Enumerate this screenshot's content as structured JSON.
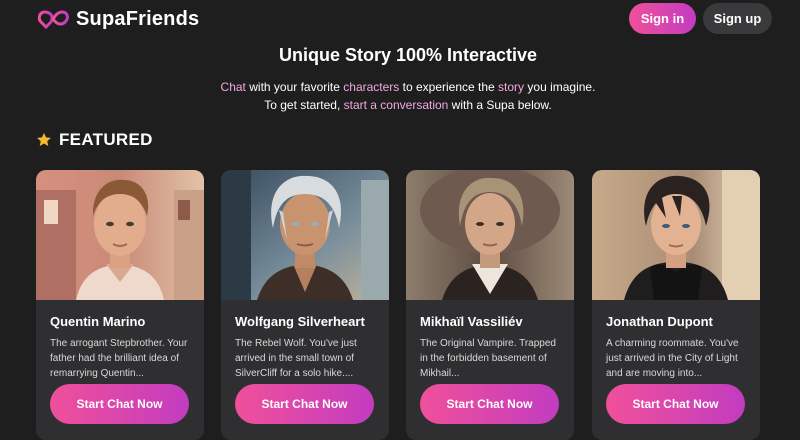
{
  "header": {
    "brand": "SupaFriends",
    "signin_label": "Sign in",
    "signup_label": "Sign up"
  },
  "hero": {
    "title": "Unique Story 100% Interactive",
    "line1": [
      "Chat",
      " with your favorite ",
      "characters",
      " to experience the ",
      "story",
      " you imagine."
    ],
    "line2": [
      "To get started, ",
      "start a conversation",
      " with a Supa below."
    ]
  },
  "featured": {
    "label": "FEATURED",
    "cards": [
      {
        "name": "Quentin Marino",
        "description": "The arrogant Stepbrother. Your father had the brilliant idea of remarrying Quentin...",
        "button": "Start Chat Now"
      },
      {
        "name": "Wolfgang Silverheart",
        "description": "The Rebel Wolf. You've just arrived in the small town of SilverCliff for a solo hike....",
        "button": "Start Chat Now"
      },
      {
        "name": "Mikhaïl Vassiliév",
        "description": "The Original Vampire. Trapped in the forbidden basement of Mikhail...",
        "button": "Start Chat Now"
      },
      {
        "name": "Jonathan Dupont",
        "description": "A charming roommate. You've just arrived in the City of Light and are moving into...",
        "button": "Start Chat Now"
      }
    ]
  },
  "colors": {
    "background": "#1e1e1f",
    "card": "#2f2f31",
    "accent_start": "#f0509a",
    "accent_end": "#c23cc0",
    "highlight_text": "#f3a8de",
    "star": "#f5b82e"
  },
  "icons": {
    "logo": "infinity-heart-logo-icon",
    "featured": "star-icon"
  }
}
